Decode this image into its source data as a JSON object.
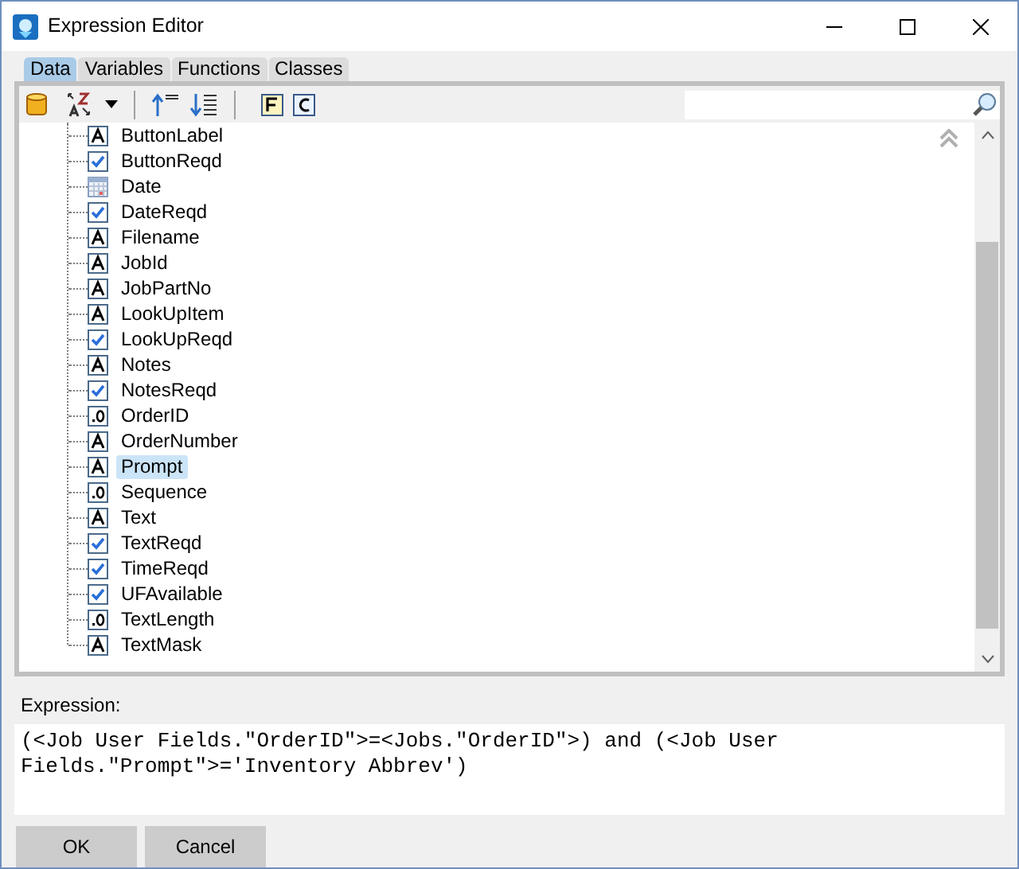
{
  "window": {
    "title": "Expression Editor"
  },
  "tabs": [
    {
      "label": "Data",
      "selected": true
    },
    {
      "label": "Variables",
      "selected": false
    },
    {
      "label": "Functions",
      "selected": false
    },
    {
      "label": "Classes",
      "selected": false
    }
  ],
  "fields": [
    {
      "name": "ButtonLabel",
      "kind": "text",
      "selected": false
    },
    {
      "name": "ButtonReqd",
      "kind": "boolean",
      "selected": false
    },
    {
      "name": "Date",
      "kind": "date",
      "selected": false
    },
    {
      "name": "DateReqd",
      "kind": "boolean",
      "selected": false
    },
    {
      "name": "Filename",
      "kind": "text",
      "selected": false
    },
    {
      "name": "JobId",
      "kind": "text",
      "selected": false
    },
    {
      "name": "JobPartNo",
      "kind": "text",
      "selected": false
    },
    {
      "name": "LookUpItem",
      "kind": "text",
      "selected": false
    },
    {
      "name": "LookUpReqd",
      "kind": "boolean",
      "selected": false
    },
    {
      "name": "Notes",
      "kind": "text",
      "selected": false
    },
    {
      "name": "NotesReqd",
      "kind": "boolean",
      "selected": false
    },
    {
      "name": "OrderID",
      "kind": "number",
      "selected": false
    },
    {
      "name": "OrderNumber",
      "kind": "text",
      "selected": false
    },
    {
      "name": "Prompt",
      "kind": "text",
      "selected": true
    },
    {
      "name": "Sequence",
      "kind": "number",
      "selected": false
    },
    {
      "name": "Text",
      "kind": "text",
      "selected": false
    },
    {
      "name": "TextReqd",
      "kind": "boolean",
      "selected": false
    },
    {
      "name": "TimeReqd",
      "kind": "boolean",
      "selected": false
    },
    {
      "name": "UFAvailable",
      "kind": "boolean",
      "selected": false
    },
    {
      "name": "TextLength",
      "kind": "number",
      "selected": false
    },
    {
      "name": "TextMask",
      "kind": "text",
      "selected": false
    }
  ],
  "expression": {
    "label": "Expression:",
    "value": "(<Job User Fields.\"OrderID\">=<Jobs.\"OrderID\">) and (<Job User Fields.\"Prompt\">='Inventory Abbrev')"
  },
  "buttons": [
    "OK",
    "Cancel"
  ]
}
